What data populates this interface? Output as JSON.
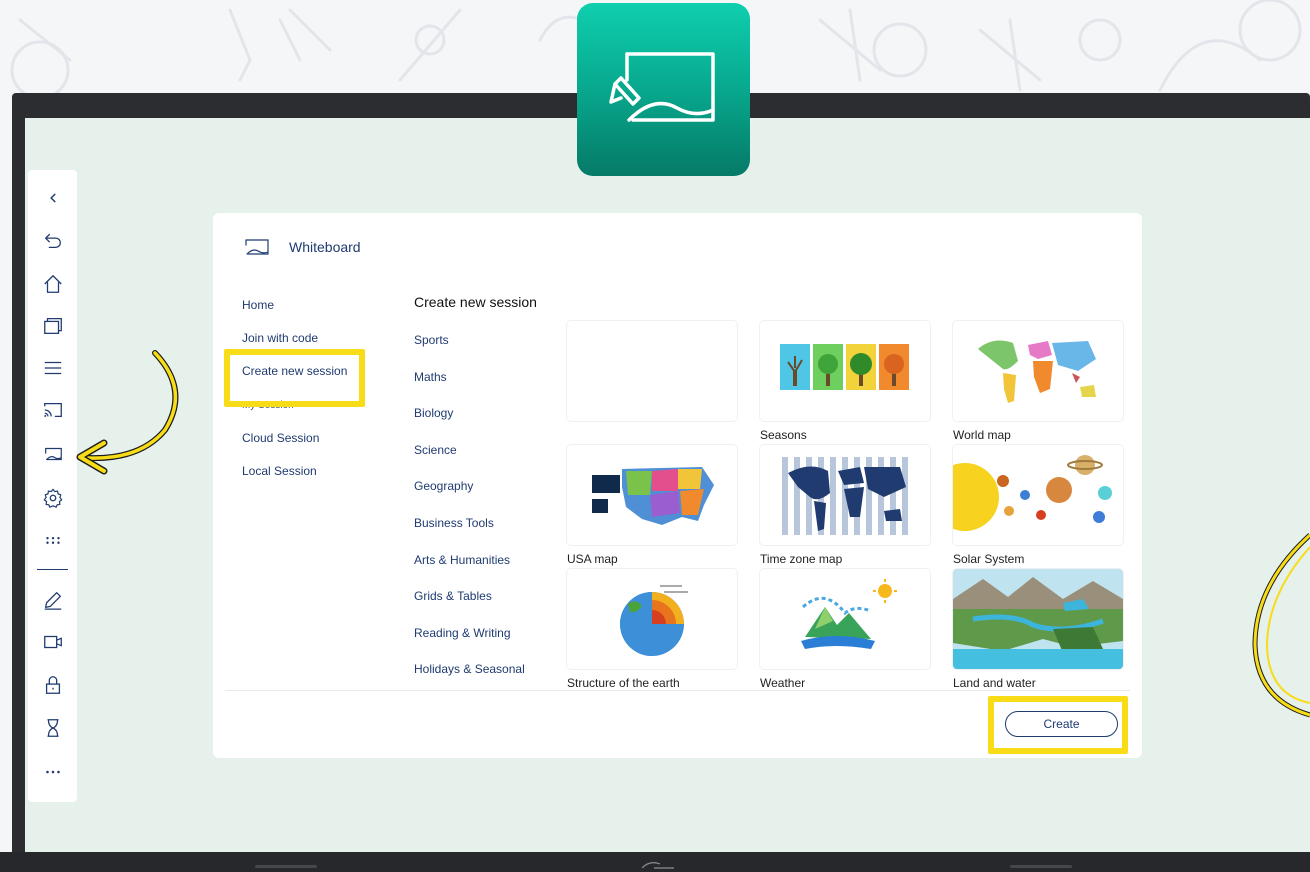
{
  "app": {
    "title": "Whiteboard",
    "icon": "whiteboard-icon"
  },
  "toolbar": {
    "items": [
      {
        "name": "collapse",
        "icon": "chevron-left-icon"
      },
      {
        "name": "undo",
        "icon": "undo-icon"
      },
      {
        "name": "home",
        "icon": "home-icon"
      },
      {
        "name": "windows",
        "icon": "windows-icon"
      },
      {
        "name": "menu",
        "icon": "menu-icon"
      },
      {
        "name": "cast",
        "icon": "cast-icon"
      },
      {
        "name": "whiteboard",
        "icon": "whiteboard-icon"
      },
      {
        "name": "settings",
        "icon": "gear-icon"
      },
      {
        "name": "apps",
        "icon": "apps-grid-icon"
      },
      {
        "name": "annotate",
        "icon": "pen-icon"
      },
      {
        "name": "camera",
        "icon": "camera-icon"
      },
      {
        "name": "lock",
        "icon": "lock-icon"
      },
      {
        "name": "timer",
        "icon": "hourglass-icon"
      },
      {
        "name": "more",
        "icon": "more-icon"
      }
    ]
  },
  "nav": {
    "home": "Home",
    "join": "Join with code",
    "create": "Create new session",
    "section": "My Session",
    "cloud": "Cloud Session",
    "local": "Local Session"
  },
  "main": {
    "heading": "Create new session",
    "categories": [
      "Sports",
      "Maths",
      "Biology",
      "Science",
      "Geography",
      "Business Tools",
      "Arts & Humanities",
      "Grids & Tables",
      "Reading & Writing",
      "Holidays & Seasonal"
    ],
    "templates": [
      {
        "label": ""
      },
      {
        "label": "Seasons"
      },
      {
        "label": "World map"
      },
      {
        "label": "USA map"
      },
      {
        "label": "Time zone map"
      },
      {
        "label": "Solar System"
      },
      {
        "label": "Structure of the earth"
      },
      {
        "label": "Weather"
      },
      {
        "label": "Land and water"
      }
    ]
  },
  "footer": {
    "create_label": "Create"
  },
  "colors": {
    "accent": "#1f3b70",
    "highlight": "#f7dc17",
    "tile_top": "#0fcfae",
    "tile_bottom": "#067a67"
  }
}
